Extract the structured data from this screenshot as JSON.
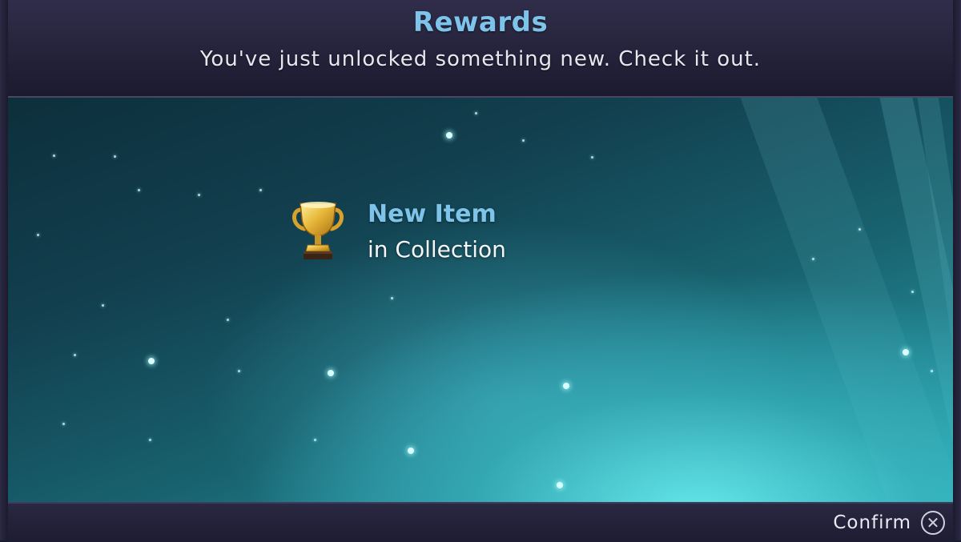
{
  "header": {
    "title": "Rewards",
    "subtitle": "You've just unlocked something new. Check it out."
  },
  "reward": {
    "icon": "trophy-icon",
    "title": "New Item",
    "subtitle": "in Collection"
  },
  "footer": {
    "confirm_label": "Confirm",
    "confirm_icon": "close-circle-icon"
  },
  "colors": {
    "accent": "#7ec4ea",
    "frame": "#1f1d33",
    "text": "#e6e7ef"
  }
}
